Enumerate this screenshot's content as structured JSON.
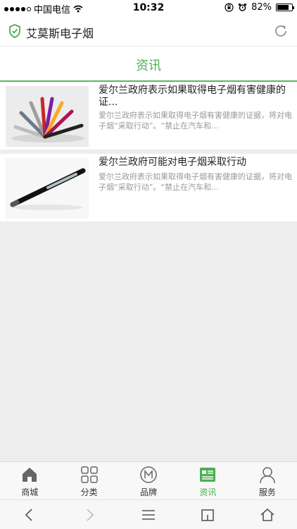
{
  "status_bar": {
    "carrier": "中国电信",
    "time": "10:32",
    "battery": "82%",
    "battery_level": 0.82
  },
  "app_header": {
    "title": "艾莫斯电子烟",
    "accent_color": "#4caf50"
  },
  "section": {
    "title": "资讯"
  },
  "news": [
    {
      "title": "爱尔兰政府表示如果取得电子烟有害健康的证...",
      "summary": "爱尔兰政府表示如果取得电子烟有害健康的证据，将对电子烟“采取行动”。“禁止在汽车和...",
      "image": "e-cigarettes-fan-image"
    },
    {
      "title": "爱尔兰政府可能对电子烟采取行动",
      "summary": "爱尔兰政府表示如果取得电子烟有害健康的证据，将对电子烟“采取行动”。“禁止在汽车和...",
      "image": "e-cigarette-pen-image"
    }
  ],
  "tabbar": {
    "tabs": [
      {
        "label": "商城",
        "icon": "home-icon"
      },
      {
        "label": "分类",
        "icon": "grid-icon"
      },
      {
        "label": "品牌",
        "icon": "brand-icon"
      },
      {
        "label": "资讯",
        "icon": "news-icon"
      },
      {
        "label": "服务",
        "icon": "user-icon"
      }
    ],
    "active_index": 3
  },
  "browser_bar": {
    "buttons": [
      "back-icon",
      "forward-icon",
      "menu-icon",
      "tabs-icon",
      "home-icon"
    ]
  }
}
